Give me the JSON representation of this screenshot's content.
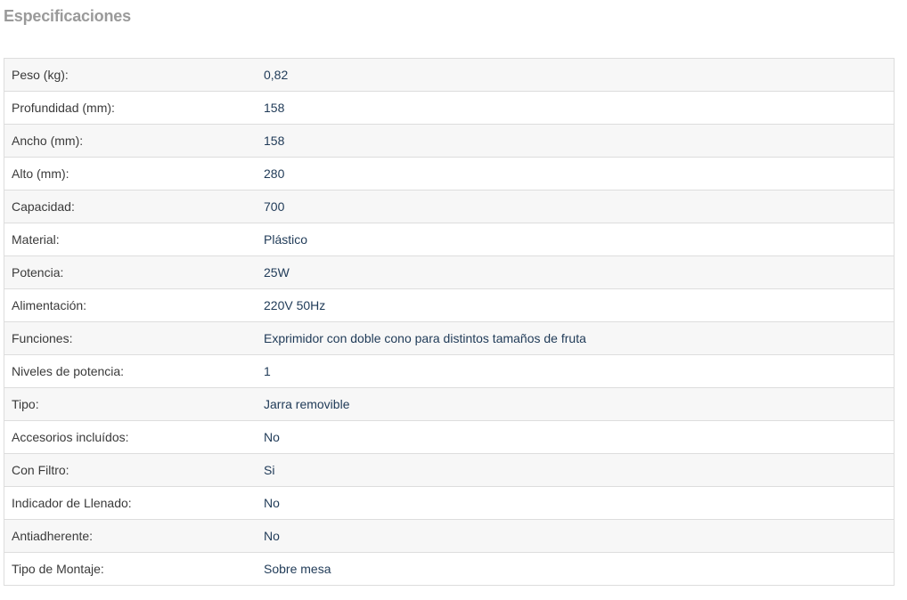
{
  "section": {
    "title": "Especificaciones"
  },
  "specs": [
    {
      "label": "Peso (kg):",
      "value": "0,82"
    },
    {
      "label": "Profundidad (mm):",
      "value": "158"
    },
    {
      "label": "Ancho (mm):",
      "value": "158"
    },
    {
      "label": "Alto (mm):",
      "value": "280"
    },
    {
      "label": "Capacidad:",
      "value": "700"
    },
    {
      "label": "Material:",
      "value": "Plástico"
    },
    {
      "label": "Potencia:",
      "value": "25W"
    },
    {
      "label": "Alimentación:",
      "value": "220V 50Hz"
    },
    {
      "label": "Funciones:",
      "value": "Exprimidor con doble cono para distintos tamaños de fruta"
    },
    {
      "label": "Niveles de potencia:",
      "value": "1"
    },
    {
      "label": "Tipo:",
      "value": "Jarra removible"
    },
    {
      "label": "Accesorios incluídos:",
      "value": "No"
    },
    {
      "label": "Con Filtro:",
      "value": "Si"
    },
    {
      "label": "Indicador de Llenado:",
      "value": "No"
    },
    {
      "label": "Antiadherente:",
      "value": "No"
    },
    {
      "label": "Tipo de Montaje:",
      "value": "Sobre mesa"
    }
  ],
  "colors": {
    "title": "#9a9a9a",
    "label": "#3a3a3a",
    "value": "#1f3a57",
    "row_alt": "#f7f7f7",
    "border": "#dddddd"
  }
}
